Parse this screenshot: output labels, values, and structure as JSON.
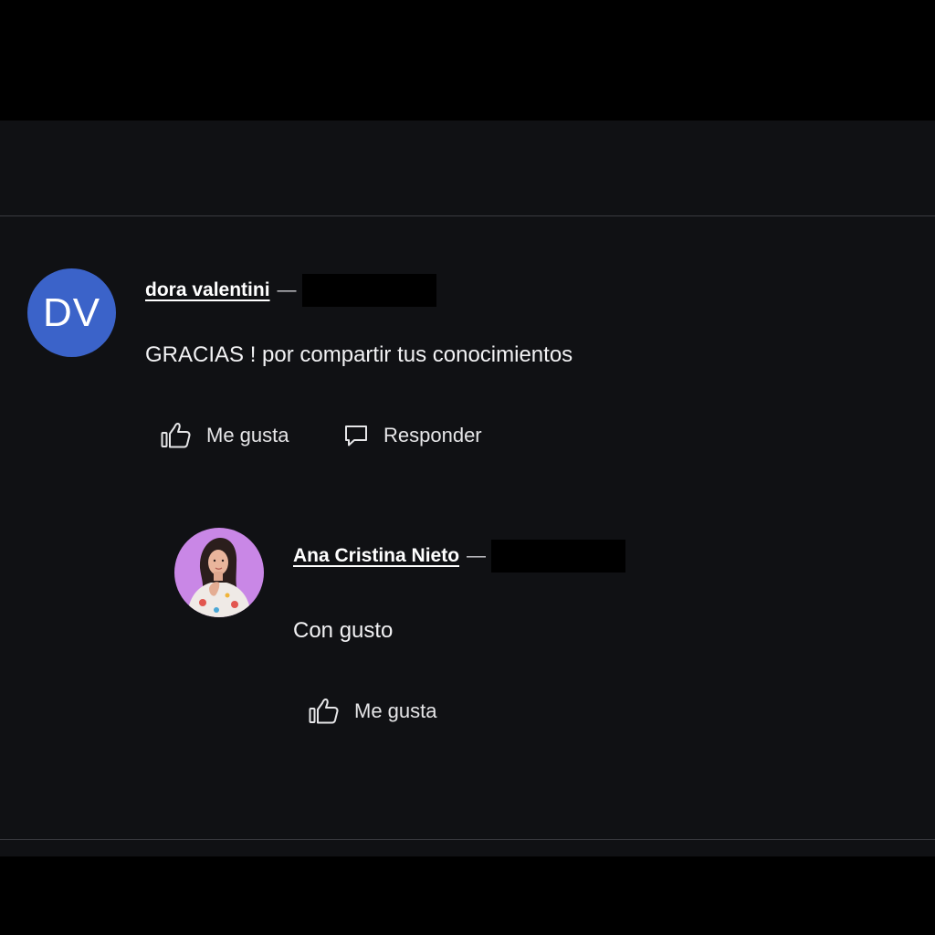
{
  "comments": [
    {
      "author": "dora valentini",
      "separator": "—",
      "avatar_initials": "DV",
      "avatar_color": "#3b63c9",
      "text": "GRACIAS ! por compartir tus conocimientos",
      "actions": {
        "like_label": "Me gusta",
        "like_icon": "thumbs-up-icon",
        "reply_label": "Responder",
        "reply_icon": "speech-bubble-icon"
      }
    },
    {
      "author": "Ana Cristina Nieto",
      "separator": "—",
      "avatar_icon": "profile-photo",
      "avatar_bg": "#c987e6",
      "text": "Con gusto",
      "actions": {
        "like_label": "Me gusta",
        "like_icon": "thumbs-up-icon"
      }
    }
  ],
  "colors": {
    "background": "#101114",
    "letterbox": "#000000",
    "text": "#f2f2f4",
    "divider": "#3a3b40"
  }
}
